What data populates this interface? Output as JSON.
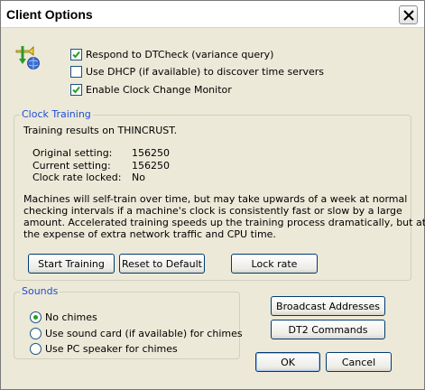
{
  "window": {
    "title": "Client Options"
  },
  "options": [
    {
      "label": "Respond to DTCheck (variance query)",
      "checked": true
    },
    {
      "label": "Use DHCP (if available) to discover time servers",
      "checked": false
    },
    {
      "label": "Enable Clock Change Monitor",
      "checked": true
    }
  ],
  "clock_training": {
    "title": "Clock Training",
    "results_text": "Training results on THINCRUST.",
    "original_label": "Original setting:",
    "original_value": "156250",
    "current_label": "Current setting:",
    "current_value": "156250",
    "locked_label": "Clock rate locked:",
    "locked_value": "No",
    "description": [
      "Machines will self-train over time, but may take upwards of a week at normal",
      "checking intervals if a machine's clock is consistently fast or slow by a large",
      "amount. Accelerated training speeds up the training process dramatically, but at",
      "the expense of extra network traffic and CPU time."
    ],
    "start_training": "Start Training",
    "reset_default": "Reset to Default",
    "lock_rate": "Lock rate"
  },
  "sounds": {
    "title": "Sounds",
    "options": [
      {
        "label": "No chimes",
        "selected": true
      },
      {
        "label": "Use sound card (if available) for chimes",
        "selected": false
      },
      {
        "label": "Use PC speaker for chimes",
        "selected": false
      }
    ]
  },
  "buttons": {
    "broadcast": "Broadcast Addresses",
    "dt2": "DT2 Commands",
    "ok": "OK",
    "cancel": "Cancel"
  }
}
